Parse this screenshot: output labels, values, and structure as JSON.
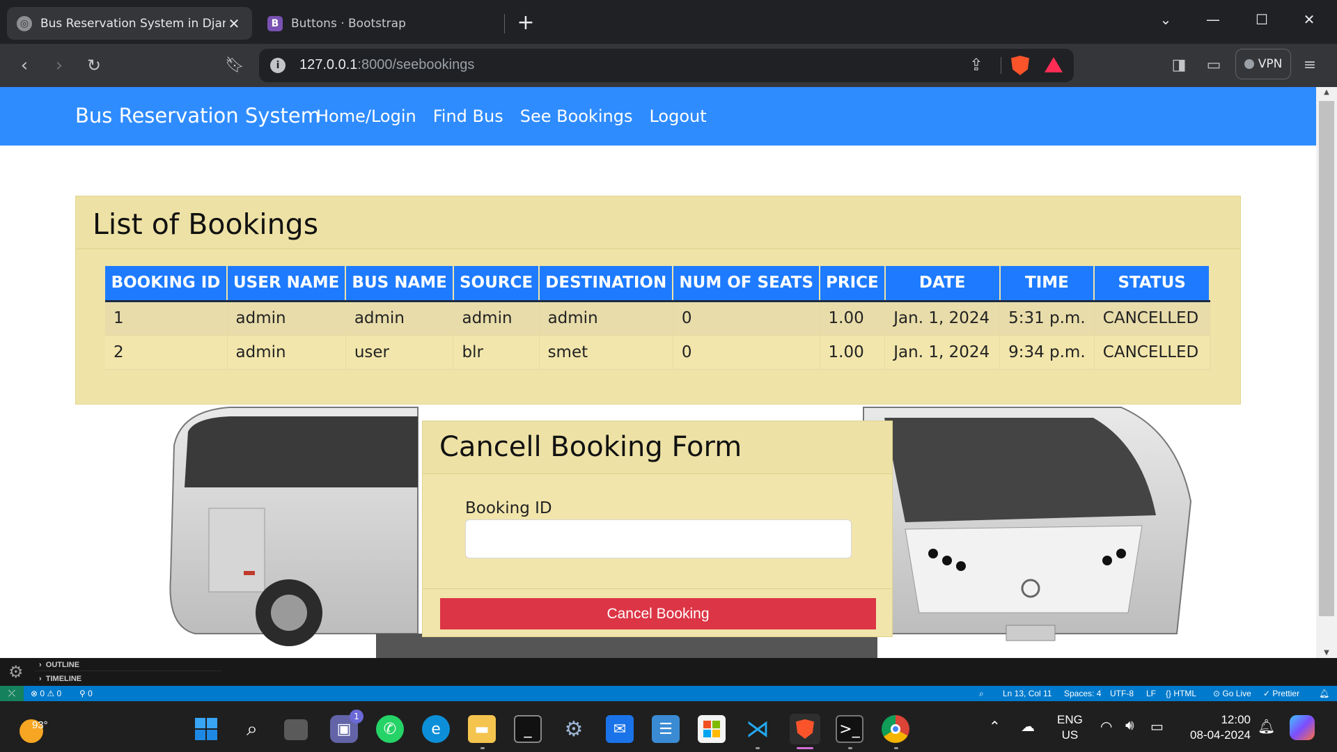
{
  "browser": {
    "tabs": [
      {
        "title": "Bus Reservation System in Djang",
        "active": true
      },
      {
        "title": "Buttons · Bootstrap",
        "active": false
      }
    ],
    "url_host": "127.0.0.1",
    "url_rest": ":8000/seebookings",
    "vpn_label": "VPN"
  },
  "navbar": {
    "brand": "Bus Reservation System",
    "links": [
      "Home/Login",
      "Find Bus",
      "See Bookings",
      "Logout"
    ]
  },
  "bookings": {
    "heading": "List of Bookings",
    "columns": [
      "BOOKING ID",
      "USER NAME",
      "BUS NAME",
      "SOURCE",
      "DESTINATION",
      "NUM OF SEATS",
      "PRICE",
      "DATE",
      "TIME",
      "STATUS"
    ],
    "rows": [
      [
        "1",
        "admin",
        "admin",
        "admin",
        "admin",
        "0",
        "1.00",
        "Jan. 1, 2024",
        "5:31 p.m.",
        "CANCELLED"
      ],
      [
        "2",
        "admin",
        "user",
        "blr",
        "smet",
        "0",
        "1.00",
        "Jan. 1, 2024",
        "9:34 p.m.",
        "CANCELLED"
      ]
    ]
  },
  "cancel_form": {
    "heading": "Cancell Booking Form",
    "field_label": "Booking ID",
    "field_value": "",
    "button_label": "Cancel Booking"
  },
  "vscode": {
    "outline_label": "OUTLINE",
    "timeline_label": "TIMELINE",
    "errors": "0",
    "warnings": "0",
    "ports": "0",
    "cursor": "Ln 13, Col 11",
    "spaces": "Spaces: 4",
    "encoding": "UTF-8",
    "eol": "LF",
    "language": "HTML",
    "golive": "Go Live",
    "prettier": "Prettier"
  },
  "taskbar": {
    "temperature": "93°",
    "chat_badge": "1",
    "lang_top": "ENG",
    "lang_bottom": "US",
    "time": "12:00",
    "date": "08-04-2024"
  },
  "colors": {
    "navbar": "#2f8cff",
    "card": "#efe3a8",
    "table_header": "#1e7bff",
    "danger": "#dc3545"
  }
}
